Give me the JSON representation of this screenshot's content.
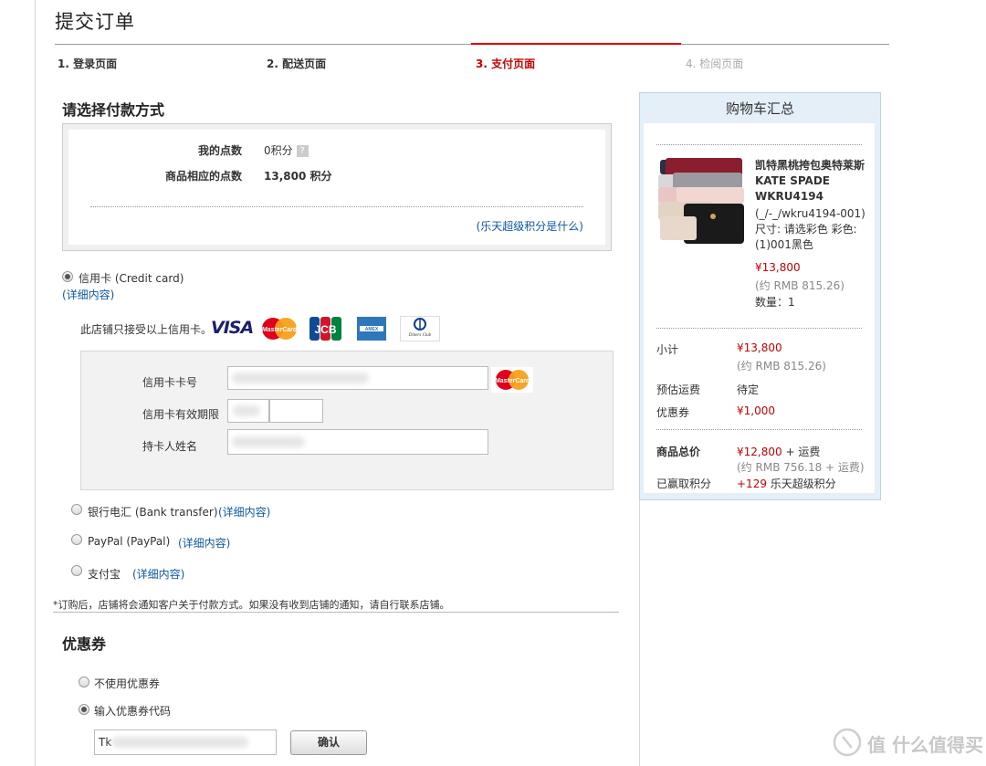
{
  "page": {
    "title": "提交订单"
  },
  "steps": [
    {
      "label": "1. 登录页面"
    },
    {
      "label": "2. 配送页面"
    },
    {
      "label": "3. 支付页面"
    },
    {
      "label": "4. 检阅页面"
    }
  ],
  "payment": {
    "heading": "请选择付款方式",
    "points": {
      "my_points_label": "我的点数",
      "my_points_value": "0积分",
      "help_icon": "?",
      "product_points_label": "商品相应的点数",
      "product_points_value": "13,800 积分",
      "what_is_link": "(乐天超级积分是什么)"
    },
    "credit_card": {
      "label": "信用卡 (Credit card)",
      "details_link": "(详细内容)",
      "accepts_text": "此店铺只接受以上信用卡。",
      "brands": [
        "VISA",
        "MasterCard",
        "JCB",
        "AMEX",
        "Diners Club"
      ],
      "card_number_label": "信用卡卡号",
      "expiry_label": "信用卡有效期限",
      "holder_label": "持卡人姓名",
      "detected_brand": "MasterCard"
    },
    "bank_transfer": {
      "label": "银行电汇 (Bank transfer)",
      "details_link": "(详细内容)"
    },
    "paypal": {
      "label": "PayPal (PayPal)",
      "details_link": "(详细内容)"
    },
    "alipay": {
      "label": "支付宝",
      "details_link": "(详细内容)"
    },
    "note": "*订购后，店铺将会通知客户关于付款方式。如果没有收到店铺的通知，请自行联系店铺。"
  },
  "coupon": {
    "heading": "优惠券",
    "option_none": "不使用优惠券",
    "option_code": "输入优惠券代码",
    "code_value": "Tk",
    "confirm_button": "确认"
  },
  "cart": {
    "title": "购物车汇总",
    "item": {
      "name": "凯特黑桃挎包奥特莱斯KATE SPADE WKRU4194",
      "sku": "(_/-_/wkru4194-001)",
      "options": "尺寸: 请选彩色 彩色: (1)001黑色",
      "price": "¥13,800",
      "price_rmb": "(约 RMB 815.26)",
      "quantity": "数量：1"
    },
    "subtotal_label": "小计",
    "subtotal_value": "¥13,800",
    "subtotal_rmb": "(约 RMB 815.26)",
    "shipping_label": "预估运费",
    "shipping_value": "待定",
    "coupon_label": "优惠券",
    "coupon_value": "¥1,000",
    "total_label": "商品总价",
    "total_value": "¥12,800",
    "total_suffix": "+ 运费",
    "total_rmb": "(约 RMB 756.18 + 运费)",
    "earned_label": "已赢取积分",
    "earned_value": "+129",
    "earned_suffix": "乐天超级积分"
  },
  "watermark": {
    "text": "值 什么值得买"
  },
  "colors": {
    "accent_red": "#cc0000",
    "link_blue": "#0a5aa8",
    "sidebar_border": "#b8d4e6"
  }
}
